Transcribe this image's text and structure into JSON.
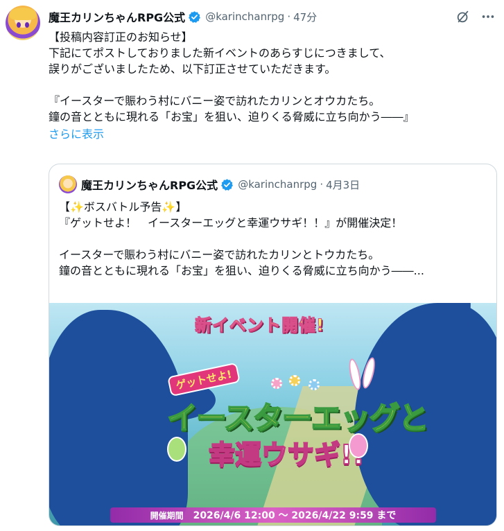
{
  "post": {
    "author_name": "魔王カリンちゃんRPG公式",
    "handle": "@karinchanrpg",
    "separator": "·",
    "time": "47分",
    "lines": [
      "【投稿内容訂正のお知らせ】",
      "下記にてポストしておりました新イベントのあらすじにつきまして、",
      "誤りがございましたため、以下訂正させていただきます。",
      "",
      "『イースターで賑わう村にバニー姿で訪れたカリンとオウカたち。",
      "鐘の音とともに現れる「お宝」を狙い、迫りくる脅威に立ち向かう――』"
    ],
    "show_more": "さらに表示"
  },
  "quote": {
    "author_name": "魔王カリンちゃんRPG公式",
    "handle": "@karinchanrpg",
    "separator": "·",
    "date": "4月3日",
    "lines": [
      "【✨ボスバトル予告✨】",
      "『ゲットせよ！　イースターエッグと幸運ウサギ！！』が開催決定！",
      "",
      "イースターで賑わう村にバニー姿で訪れたカリンとトウカたち。",
      "鐘の音とともに現れる「お宝」を狙い、迫りくる脅威に立ち向かう――..."
    ]
  },
  "banner": {
    "event_title": "新イベント開催!",
    "get_label": "ゲットせよ!",
    "logo_main": "イースターエッグと",
    "logo_sub": "幸運ウサギ!!",
    "period_label": "開催期間",
    "period_dates": "2026/4/6 12:00 ～ 2026/4/22 9:59 まで"
  },
  "icons": {
    "verified": "verified-badge-icon",
    "grok": "grok-icon",
    "more": "more-icon"
  },
  "colors": {
    "link": "#1d9bf0",
    "verified": "#1d9bf0",
    "muted": "#536471",
    "silhouette": "#1e4f9c"
  }
}
